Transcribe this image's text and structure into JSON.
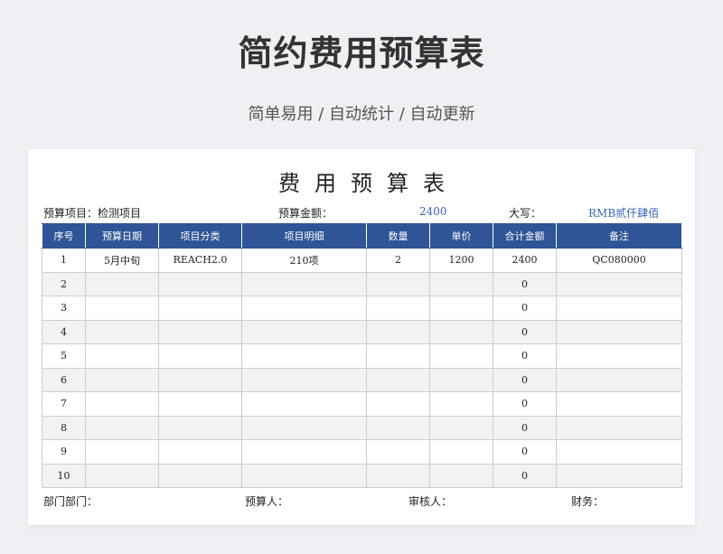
{
  "hero": {
    "title": "简约费用预算表",
    "subtitle": "简单易用 / 自动统计 / 自动更新"
  },
  "sheet": {
    "title": "费用预算表",
    "info": {
      "project_label": "预算项目：检测项目",
      "amount_label": "预算金额：",
      "amount_value": "2400",
      "capital_label": "大写：",
      "capital_value": "RMB贰仟肆佰"
    },
    "columns": [
      "序号",
      "预算日期",
      "项目分类",
      "项目明细",
      "数量",
      "单价",
      "合计金额",
      "备注"
    ],
    "rows": [
      [
        "1",
        "5月中旬",
        "REACH2.0",
        "210项",
        "2",
        "1200",
        "2400",
        "QC080000"
      ],
      [
        "2",
        "",
        "",
        "",
        "",
        "",
        "0",
        ""
      ],
      [
        "3",
        "",
        "",
        "",
        "",
        "",
        "0",
        ""
      ],
      [
        "4",
        "",
        "",
        "",
        "",
        "",
        "0",
        ""
      ],
      [
        "5",
        "",
        "",
        "",
        "",
        "",
        "0",
        ""
      ],
      [
        "6",
        "",
        "",
        "",
        "",
        "",
        "0",
        ""
      ],
      [
        "7",
        "",
        "",
        "",
        "",
        "",
        "0",
        ""
      ],
      [
        "8",
        "",
        "",
        "",
        "",
        "",
        "0",
        ""
      ],
      [
        "9",
        "",
        "",
        "",
        "",
        "",
        "0",
        ""
      ],
      [
        "10",
        "",
        "",
        "",
        "",
        "",
        "0",
        ""
      ]
    ],
    "footer": {
      "department": "部门部门：",
      "budget_person": "预算人：",
      "reviewer": "审核人：",
      "finance": "财务："
    }
  },
  "colors": {
    "header_blue": "#2f5497",
    "value_blue": "#3a63b8",
    "background": "#eef0f4"
  }
}
